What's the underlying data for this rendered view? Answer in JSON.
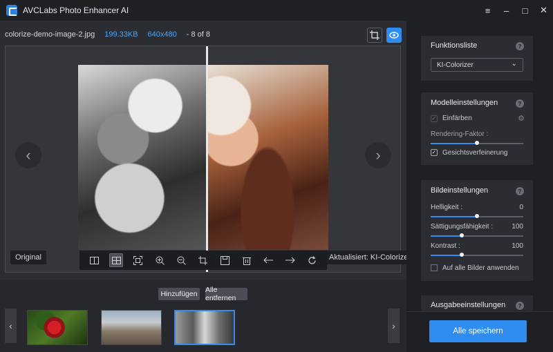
{
  "app": {
    "title": "AVCLabs Photo Enhancer AI"
  },
  "window": {
    "menu": "≡",
    "minimize": "–",
    "maximize": "□",
    "close": "✕"
  },
  "file": {
    "name": "colorize-demo-image-2.jpg",
    "size": "199.33KB",
    "dimensions": "640x480",
    "position": "- 8 of 8"
  },
  "viewer": {
    "original_label": "Original",
    "updated_label": "Aktualisiert: KI-Colorizer",
    "prev_arrow": "‹",
    "next_arrow": "›"
  },
  "toolbar": {
    "icons": [
      "split-view-icon",
      "compare-view-icon",
      "fit-screen-icon",
      "zoom-in-icon",
      "zoom-out-icon",
      "crop-icon",
      "save-icon",
      "delete-icon",
      "arrow-left-icon",
      "arrow-right-icon",
      "rotate-icon"
    ]
  },
  "thumbs": {
    "add_label": "Hinzufügen",
    "remove_all_label": "Alle entfernen",
    "prev": "‹",
    "next": "›"
  },
  "sidebar": {
    "function_panel": {
      "title": "Funktionsliste",
      "selected": "KI-Colorizer"
    },
    "model_panel": {
      "title": "Modelleinstellungen",
      "colorize_label": "Einfärben",
      "rendering_label": "Rendering-Faktor :",
      "rendering_value": 0.5,
      "face_label": "Gesichtsverfeinerung"
    },
    "image_panel": {
      "title": "Bildeinstellungen",
      "brightness_label": "Helligkeit :",
      "brightness_value": "0",
      "saturation_label": "Sättigungsfähigkeit :",
      "saturation_value": "100",
      "contrast_label": "Kontrast :",
      "contrast_value": "100",
      "apply_all_label": "Auf alle Bilder anwenden"
    },
    "output_panel": {
      "title": "Ausgabeeinstellungen"
    },
    "save_all_label": "Alle speichern"
  },
  "colors": {
    "accent": "#2f8cf0",
    "background": "#2b2d33",
    "sidebar": "#1f2024"
  }
}
